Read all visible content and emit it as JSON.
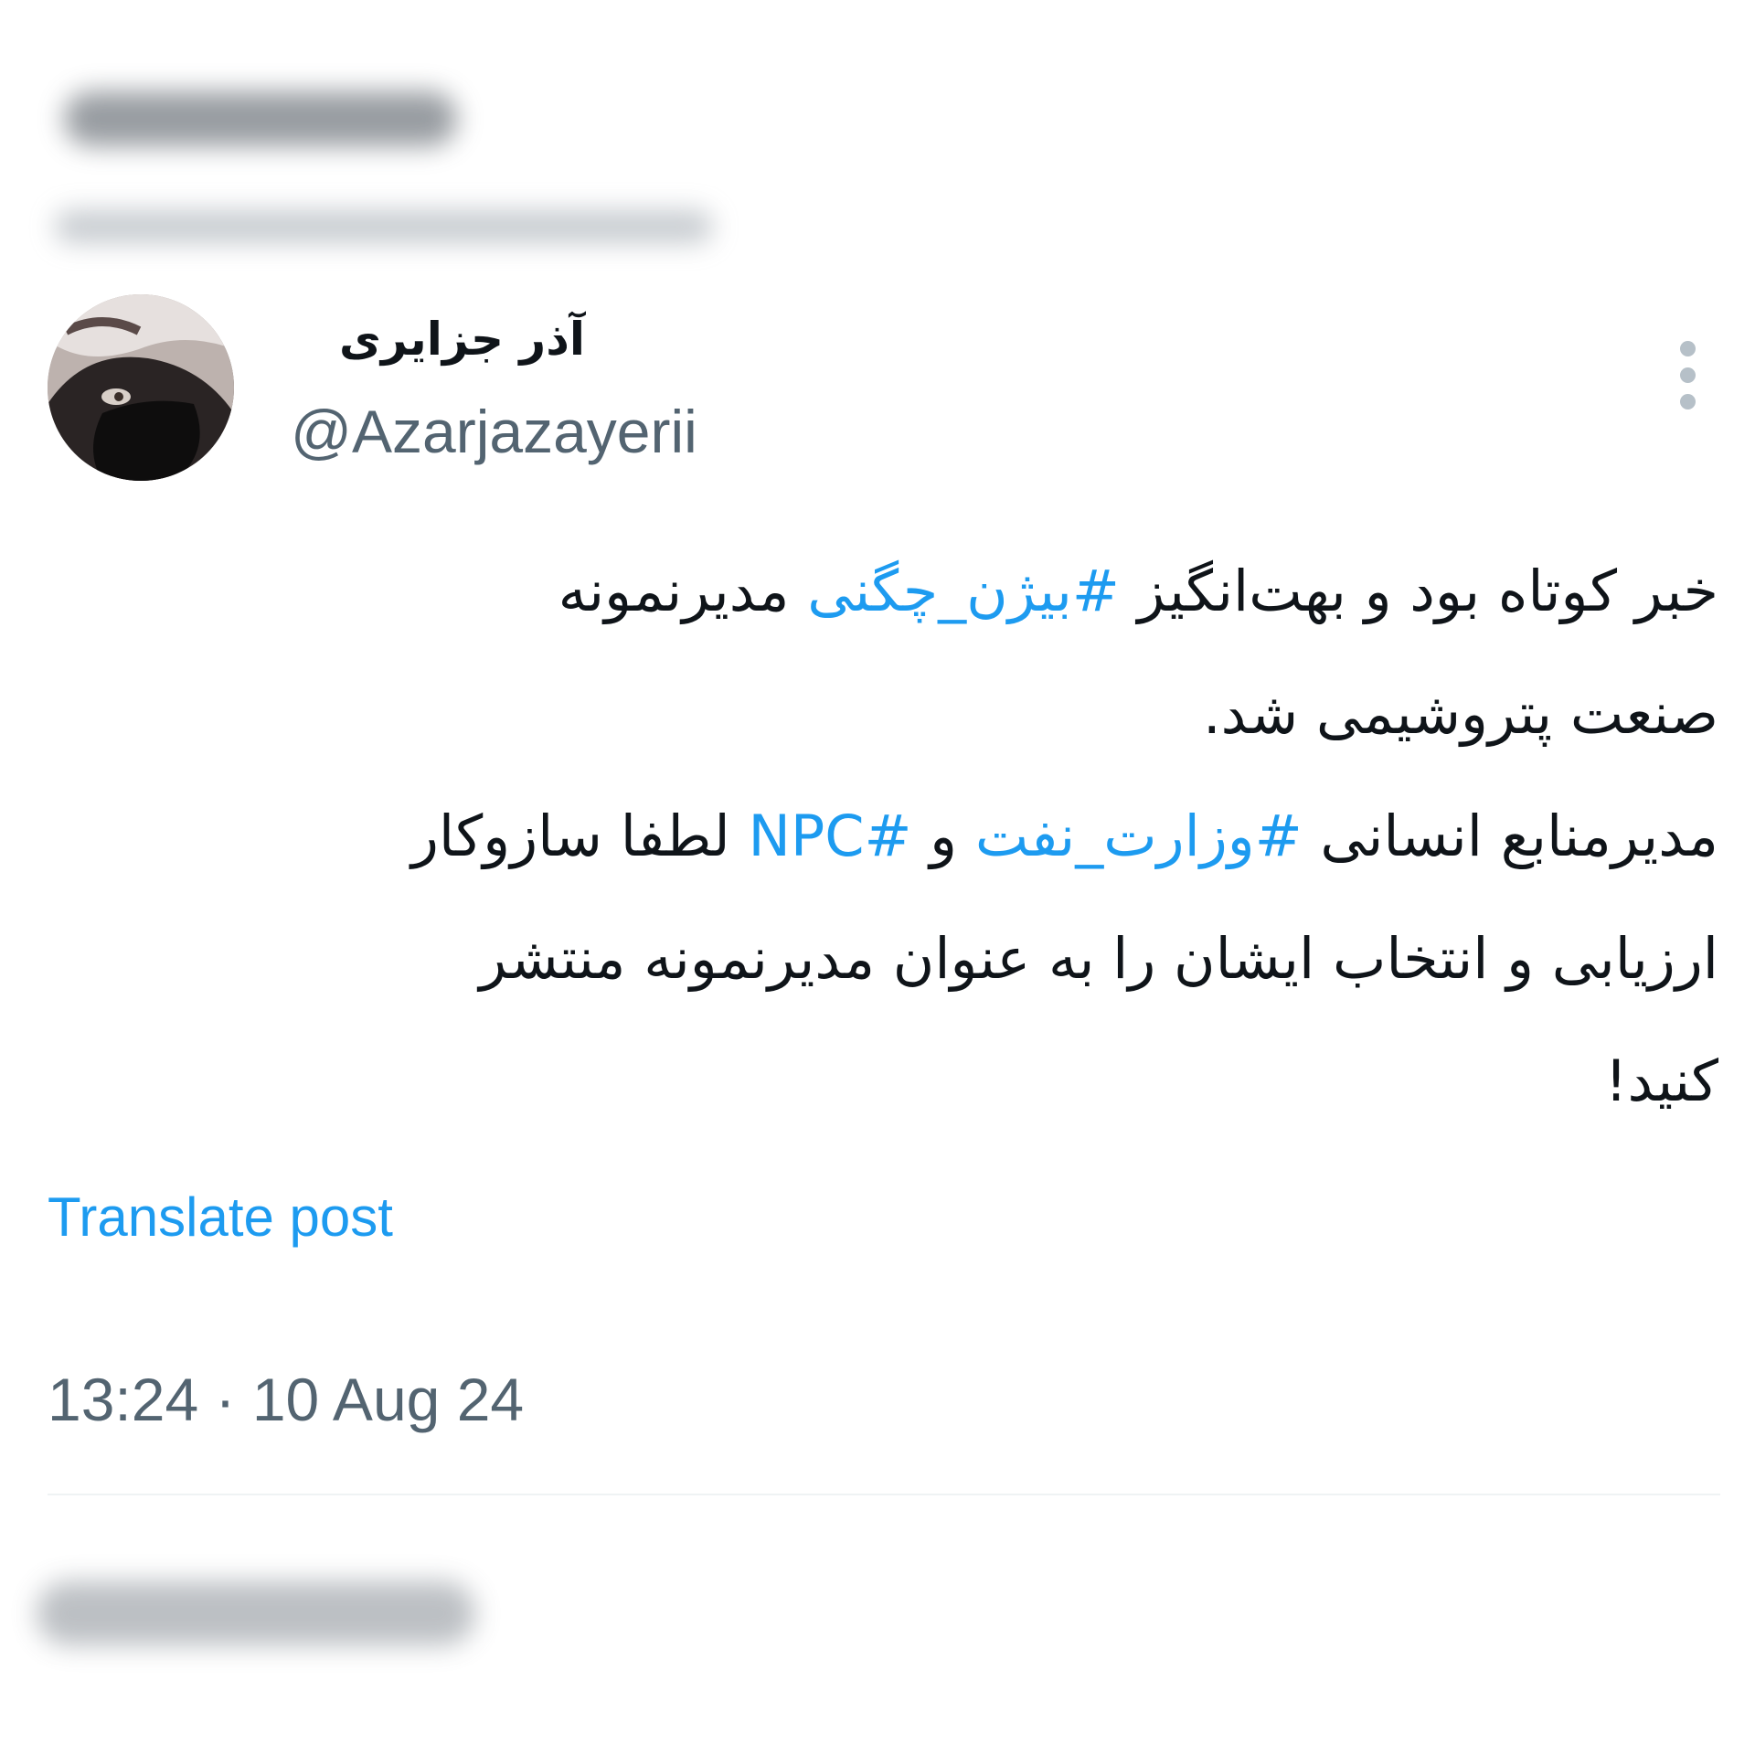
{
  "author": {
    "display_name": "آذر جزایری",
    "handle": "@Azarjazayerii"
  },
  "tweet": {
    "lines": [
      [
        {
          "text": "خبر کوتاه بود و بهت‌انگیز ",
          "tag": false
        },
        {
          "text": "#بیژن_چگنی",
          "tag": true
        },
        {
          "text": " مدیرنمونه",
          "tag": false
        }
      ],
      [
        {
          "text": "صنعت پتروشیمی شد.",
          "tag": false
        }
      ],
      [
        {
          "text": "مدیرمنابع انسانی ",
          "tag": false
        },
        {
          "text": "#وزارت_نفت",
          "tag": true
        },
        {
          "text": " و ",
          "tag": false
        },
        {
          "text": "#NPC",
          "tag": true
        },
        {
          "text": " لطفا سازوکار",
          "tag": false
        }
      ],
      [
        {
          "text": "ارزیابی و انتخاب ایشان را به عنوان مدیرنمونه منتشر",
          "tag": false
        }
      ],
      [
        {
          "text": "کنید!",
          "tag": false
        }
      ]
    ]
  },
  "translate_label": "Translate post",
  "timestamp": "13:24 · 10 Aug 24",
  "colors": {
    "link": "#1d9bf0",
    "secondary_text": "#536471",
    "primary_text": "#0f1419",
    "divider": "#eff3f4"
  },
  "icons": {
    "more": "more-vertical-icon"
  }
}
